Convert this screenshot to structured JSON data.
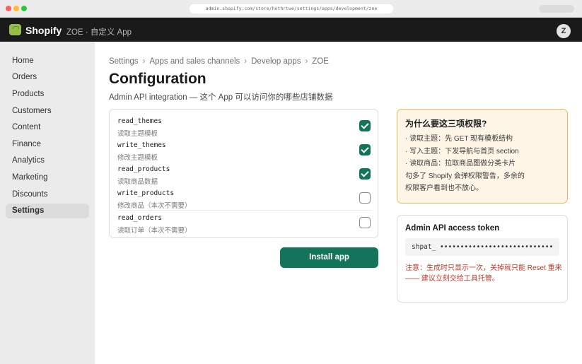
{
  "browser": {
    "url": "admin.shopify.com/store/hothrtwe/settings/apps/development/zoe"
  },
  "topbar": {
    "brand": "Shopify",
    "store": "ZOE · 自定义 App",
    "avatar_initial": "Z"
  },
  "sidebar": {
    "items": [
      {
        "label": "Home"
      },
      {
        "label": "Orders"
      },
      {
        "label": "Products"
      },
      {
        "label": "Customers"
      },
      {
        "label": "Content"
      },
      {
        "label": "Finance"
      },
      {
        "label": "Analytics"
      },
      {
        "label": "Marketing"
      },
      {
        "label": "Discounts"
      },
      {
        "label": "Settings",
        "active": true
      }
    ]
  },
  "main": {
    "breadcrumb": [
      "Settings",
      "Apps and sales channels",
      "Develop apps",
      "ZOE"
    ],
    "breadcrumb_separator": "›",
    "title": "Configuration",
    "subtitle": "Admin API integration — 这个 App 可以访问你的哪些店铺数据",
    "scopes": [
      {
        "name": "read_themes",
        "desc": "读取主题模板",
        "checked": true
      },
      {
        "name": "write_themes",
        "desc": "修改主题模板",
        "checked": true
      },
      {
        "name": "read_products",
        "desc": "读取商品数据",
        "checked": true
      },
      {
        "name": "write_products",
        "desc": "修改商品（本次不需要）",
        "checked": false
      },
      {
        "name": "read_orders",
        "desc": "读取订单（本次不需要）",
        "checked": false
      }
    ],
    "install_label": "Install app"
  },
  "note": {
    "title": "为什么要这三项权限?",
    "lines": [
      "· 读取主题：先 GET 现有模板结构",
      "· 写入主题：下发导航与首页 section",
      "· 读取商品：拉取商品图做分类卡片",
      "勾多了 Shopify 会弹权限警告，多余的",
      "权限客户看到也不放心。"
    ]
  },
  "token": {
    "title": "Admin API access token",
    "value": "shpat_ ••••••••••••••••••••••••••••",
    "warning": "注意：生成时只显示一次，关掉就只能 Reset 重来 —— 建议立刻交给工具托管。"
  },
  "colors": {
    "primary": "#13745b",
    "topbar": "#1a1a1a",
    "note_bg": "#fff5e6",
    "note_border": "#f0b95a",
    "warning": "#c0392b",
    "logo": "#95bf47"
  }
}
